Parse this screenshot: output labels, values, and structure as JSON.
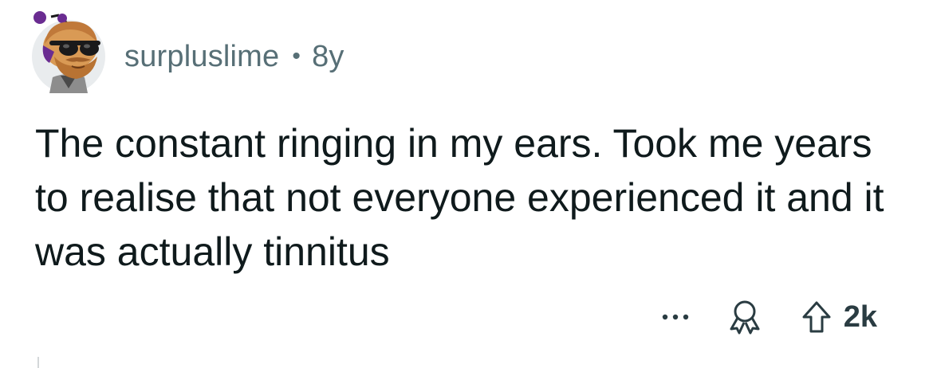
{
  "comment": {
    "author": "surpluslime",
    "separator": "•",
    "age": "8y",
    "body": "The constant ringing in my ears. Took me years to realise that not everyone experienced it and it was actually tinnitus"
  },
  "actions": {
    "more_icon": "ellipsis-icon",
    "award_icon": "award-icon",
    "upvote_icon": "upvote-arrow-icon",
    "vote_count": "2k"
  },
  "colors": {
    "meta_text": "#576f76",
    "body_text": "#0f1a1c",
    "avatar_bg": "#e9ecee",
    "avatar_accent": "#6a2c91"
  }
}
